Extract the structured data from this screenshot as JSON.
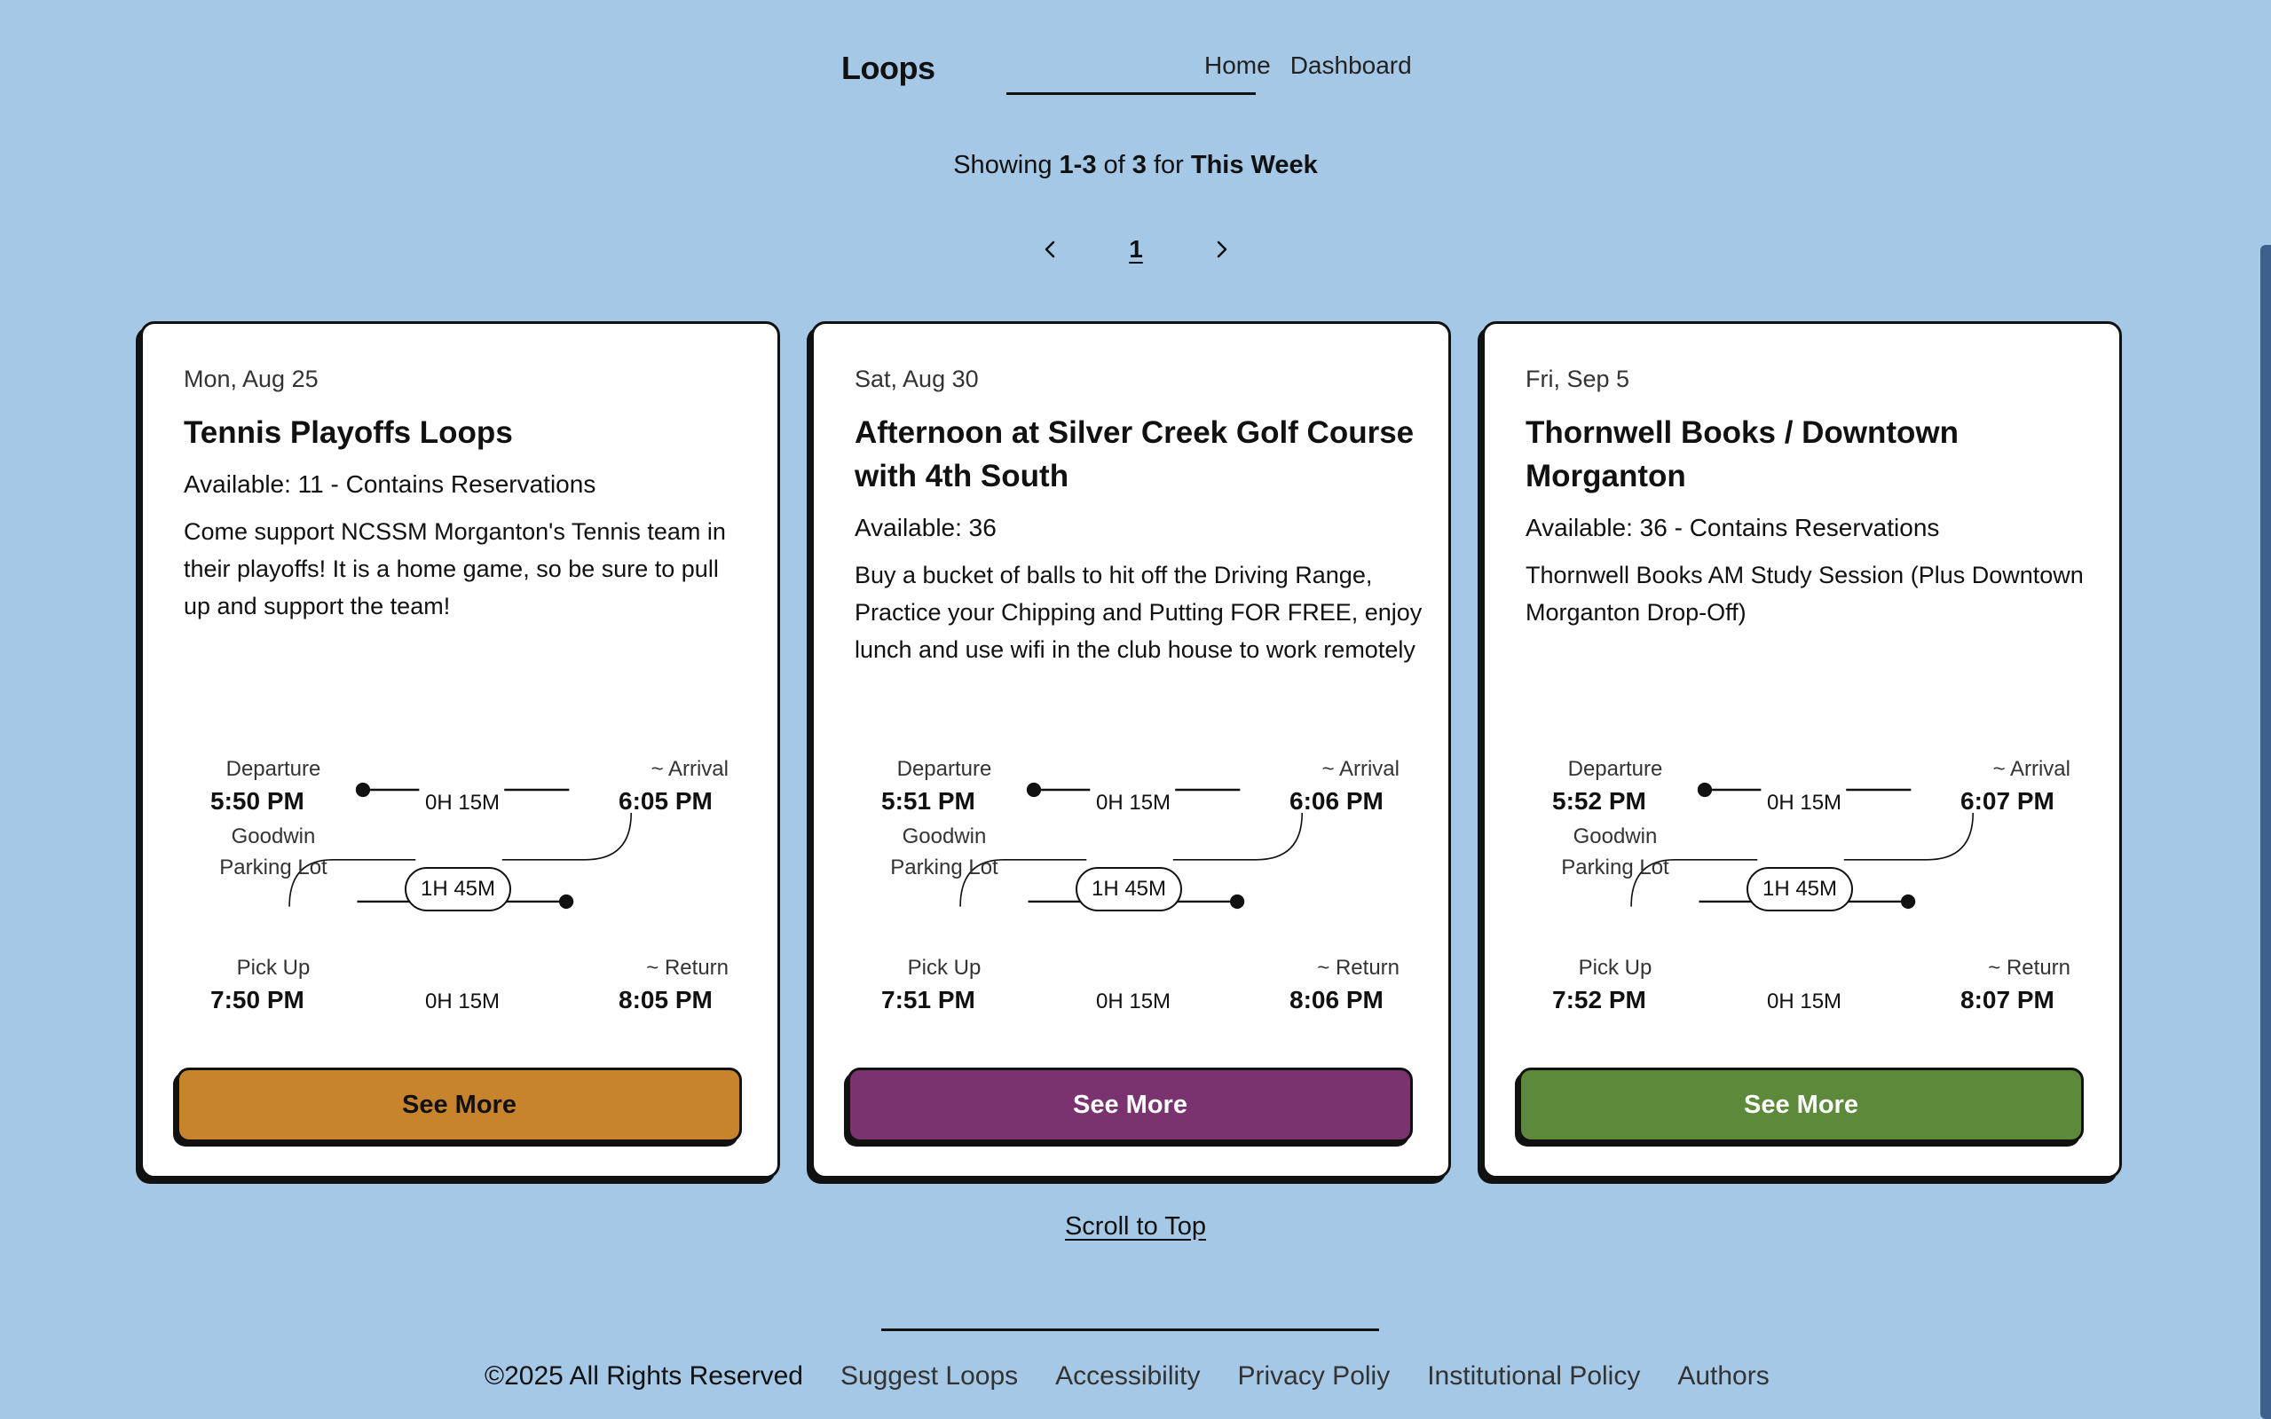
{
  "header": {
    "logo": "Loops",
    "nav": [
      {
        "label": "Home"
      },
      {
        "label": "Dashboard"
      }
    ]
  },
  "summary": {
    "prefix": "Showing ",
    "range": "1-3",
    "of": " of ",
    "total": "3",
    "for": " for ",
    "period": "This Week"
  },
  "pager": {
    "current": "1",
    "prev_icon": "chevron-left-icon",
    "next_icon": "chevron-right-icon"
  },
  "cards": [
    {
      "date": "Mon, Aug 25",
      "title": "Tennis Playoffs Loops",
      "available": "Available: 11 - Contains Reservations",
      "description": "Come support NCSSM Morganton's Tennis team in their playoffs! It is a home game, so be sure to pull up and support the team!",
      "departure_label": "Departure",
      "departure_time": "5:50 PM",
      "departure_place": "Goodwin Parking Lot",
      "leg_out": "0H 15M",
      "arrival_label": "~ Arrival",
      "arrival_time": "6:05 PM",
      "stay": "1H 45M",
      "pickup_label": "Pick Up",
      "pickup_time": "7:50 PM",
      "leg_back": "0H 15M",
      "return_label": "~ Return",
      "return_time": "8:05 PM",
      "button": "See More",
      "button_color": "#c8832d",
      "button_text_color": "#111111"
    },
    {
      "date": "Sat, Aug 30",
      "title": "Afternoon at Silver Creek Golf Course with 4th South",
      "available": "Available: 36",
      "description": "Buy a bucket of balls to hit off the Driving Range, Practice your Chipping and Putting FOR FREE, enjoy lunch and use wifi in the club house to work remotely",
      "departure_label": "Departure",
      "departure_time": "5:51 PM",
      "departure_place": "Goodwin Parking Lot",
      "leg_out": "0H 15M",
      "arrival_label": "~ Arrival",
      "arrival_time": "6:06 PM",
      "stay": "1H 45M",
      "pickup_label": "Pick Up",
      "pickup_time": "7:51 PM",
      "leg_back": "0H 15M",
      "return_label": "~ Return",
      "return_time": "8:06 PM",
      "button": "See More",
      "button_color": "#7a336e",
      "button_text_color": "#ffffff"
    },
    {
      "date": "Fri, Sep 5",
      "title": "Thornwell Books / Downtown Morganton",
      "available": "Available: 36 - Contains Reservations",
      "description": "Thornwell Books AM Study Session (Plus Downtown Morganton Drop-Off)",
      "departure_label": "Departure",
      "departure_time": "5:52 PM",
      "departure_place": "Goodwin Parking Lot",
      "leg_out": "0H 15M",
      "arrival_label": "~ Arrival",
      "arrival_time": "6:07 PM",
      "stay": "1H 45M",
      "pickup_label": "Pick Up",
      "pickup_time": "7:52 PM",
      "leg_back": "0H 15M",
      "return_label": "~ Return",
      "return_time": "8:07 PM",
      "button": "See More",
      "button_color": "#5c8a3a",
      "button_text_color": "#ffffff"
    }
  ],
  "scroll_top": "Scroll to Top",
  "footer": {
    "copyright": "©2025 All Rights Reserved",
    "links": [
      {
        "label": "Suggest Loops"
      },
      {
        "label": "Accessibility"
      },
      {
        "label": "Privacy Poliy"
      },
      {
        "label": "Institutional Policy"
      },
      {
        "label": "Authors"
      }
    ]
  },
  "colors": {
    "background": "#a4c8e6",
    "card": "#ffffff",
    "ink": "#111111",
    "scrollbar": "#3d5f8c"
  }
}
